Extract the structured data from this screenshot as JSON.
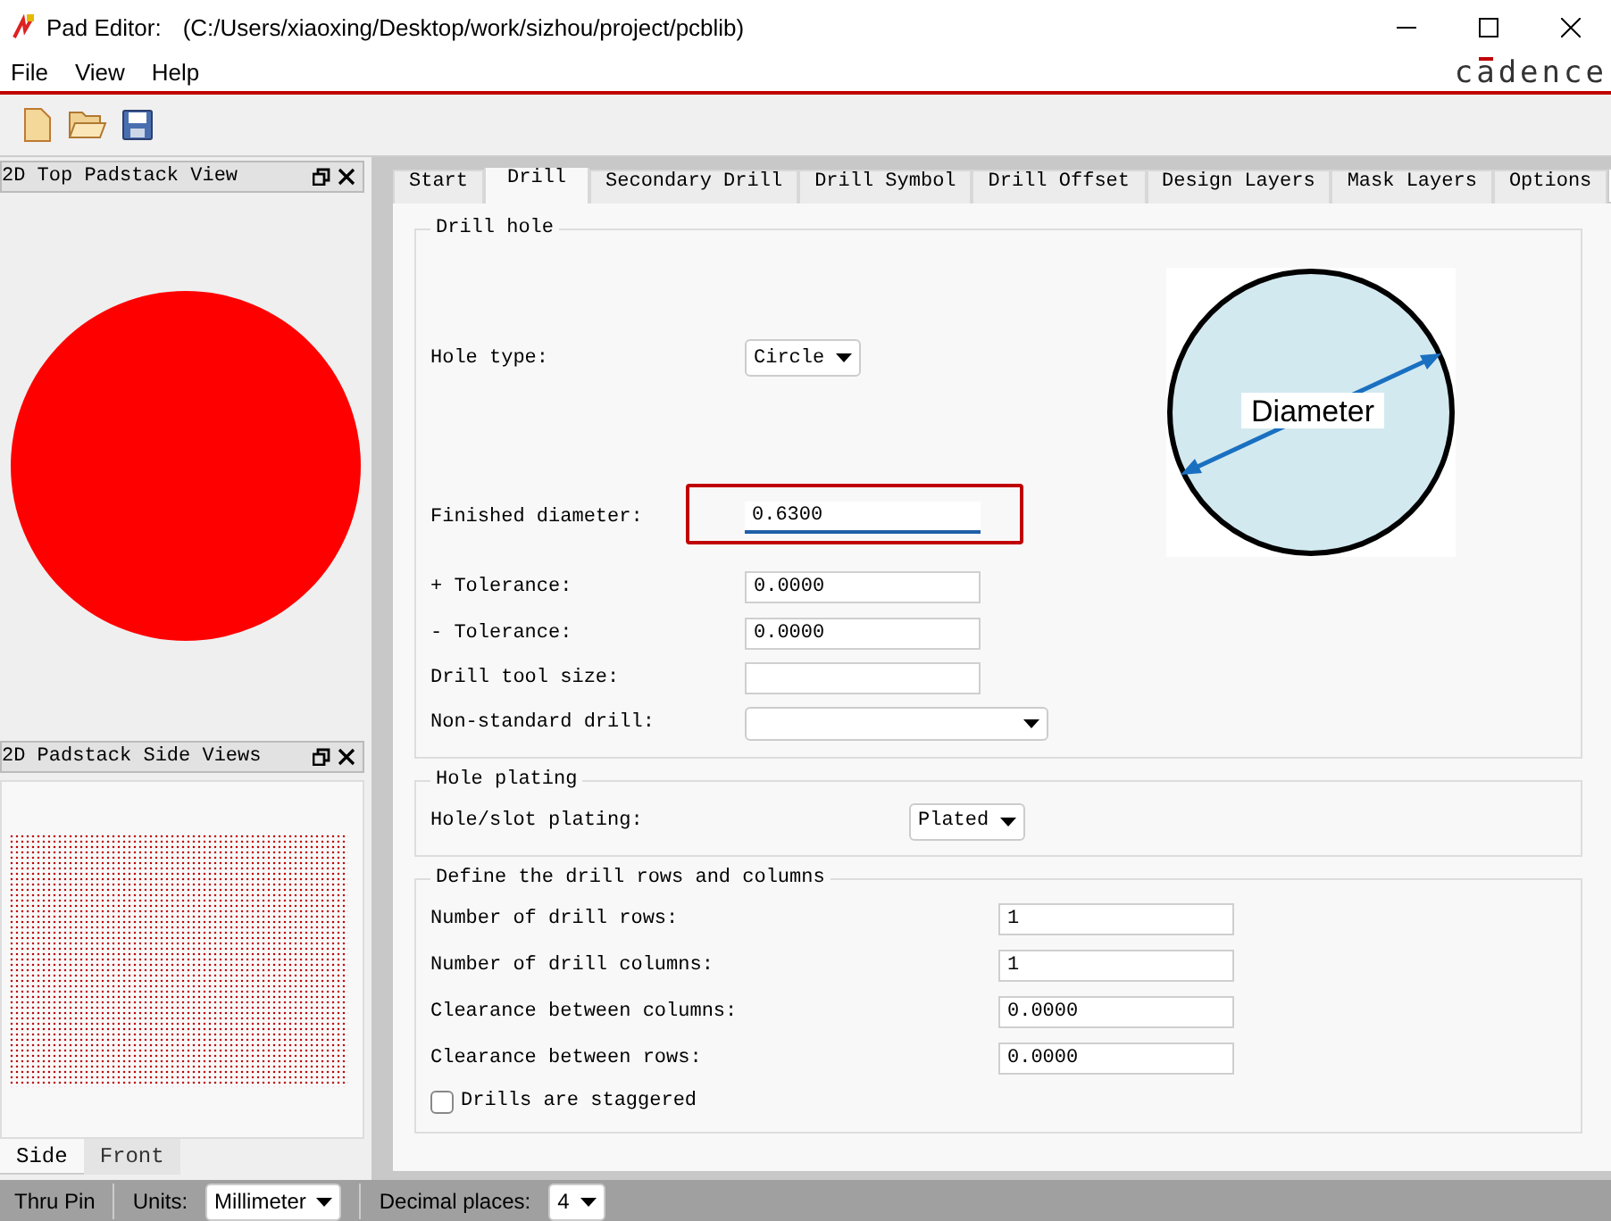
{
  "window": {
    "title": "Pad Editor:",
    "path": "(C:/Users/xiaoxing/Desktop/work/sizhou/project/pcblib)",
    "logo": "cadence"
  },
  "menu": [
    "File",
    "View",
    "Help"
  ],
  "left_panels": [
    {
      "title": "2D Top Padstack View"
    },
    {
      "title": "2D Padstack Side Views"
    }
  ],
  "side_tabs": [
    {
      "label": "Side",
      "selected": true
    },
    {
      "label": "Front",
      "selected": false
    }
  ],
  "tabs": [
    {
      "label": "Start",
      "selected": false
    },
    {
      "label": "Drill",
      "selected": true
    },
    {
      "label": "Secondary Drill",
      "selected": false
    },
    {
      "label": "Drill Symbol",
      "selected": false
    },
    {
      "label": "Drill Offset",
      "selected": false
    },
    {
      "label": "Design Layers",
      "selected": false
    },
    {
      "label": "Mask Layers",
      "selected": false
    },
    {
      "label": "Options",
      "selected": false
    }
  ],
  "drill_hole": {
    "title": "Drill hole",
    "diagram_label": "Diameter",
    "fields": [
      {
        "kind": "dropdown",
        "label": "Hole type:",
        "value": "Circle",
        "highlighted": false,
        "focused": false
      },
      {
        "kind": "input",
        "label": "Finished diameter:",
        "value": "0.6300",
        "highlighted": true,
        "focused": true
      },
      {
        "kind": "input",
        "label": "+ Tolerance:",
        "value": "0.0000",
        "highlighted": false,
        "focused": false
      },
      {
        "kind": "input",
        "label": "- Tolerance:",
        "value": "0.0000",
        "highlighted": false,
        "focused": false
      },
      {
        "kind": "input",
        "label": "Drill tool size:",
        "highlighted": false,
        "focused": false
      },
      {
        "kind": "dropdown",
        "label": "Non-standard drill:",
        "highlighted": false,
        "focused": false
      }
    ]
  },
  "hole_plating": {
    "title": "Hole plating",
    "label": "Hole/slot plating:",
    "value": "Plated"
  },
  "drill_rows": {
    "title": "Define the drill rows and columns",
    "fields": [
      {
        "label": "Number of drill rows:",
        "value": "1"
      },
      {
        "label": "Number of drill columns:",
        "value": "1"
      },
      {
        "label": "Clearance between columns:",
        "value": "0.0000"
      },
      {
        "label": "Clearance between rows:",
        "value": "0.0000"
      }
    ],
    "staggered": {
      "label": "Drills are staggered",
      "checked": false
    }
  },
  "status_bar": {
    "type": "Thru Pin",
    "units_label": "Units:",
    "units": "Millimeter",
    "decimal_label": "Decimal places:",
    "decimal": "4"
  }
}
